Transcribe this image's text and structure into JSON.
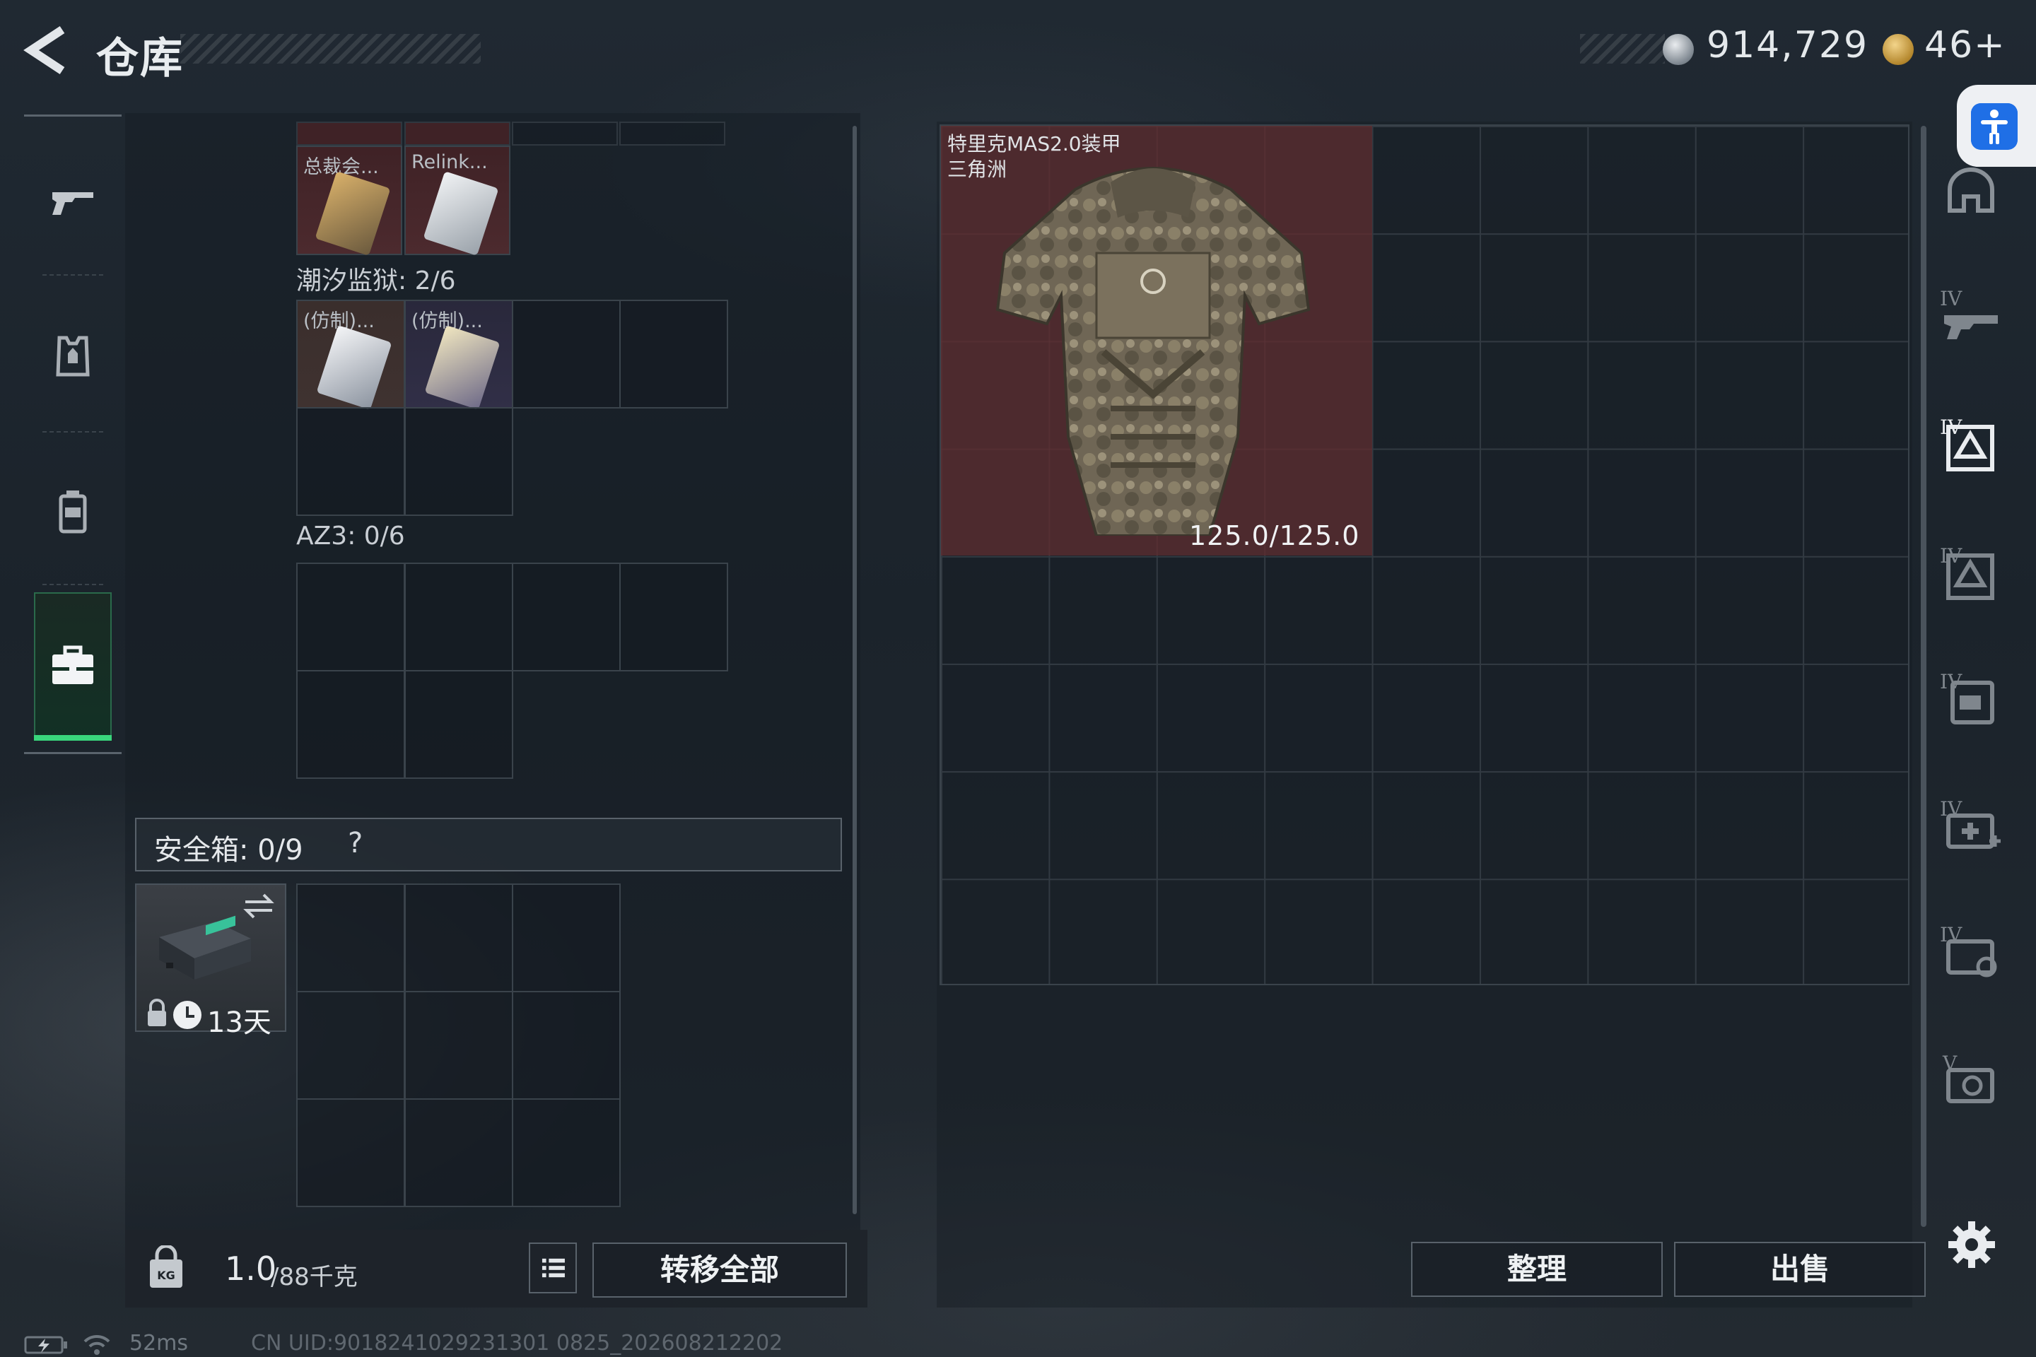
{
  "header": {
    "title": "仓库",
    "currency_silver": "914,729",
    "currency_gold": "46+"
  },
  "nav": {
    "items": [
      "weapons",
      "armor",
      "backpack",
      "storage"
    ],
    "active": "storage"
  },
  "left_panel": {
    "top_items": [
      {
        "name": "总裁会..."
      },
      {
        "name": "Relink..."
      }
    ],
    "sections": [
      {
        "label": "潮汐监狱: 2/6",
        "items": [
          {
            "name": "(仿制)..."
          },
          {
            "name": "(仿制)..."
          }
        ]
      },
      {
        "label": "AZ3: 0/6",
        "items": []
      }
    ],
    "safebox": {
      "label": "安全箱: 0/9",
      "help": "?",
      "timer": "13天"
    }
  },
  "bottom_left": {
    "weight_current": "1.0",
    "weight_max": "/88千克",
    "transfer_all": "转移全部"
  },
  "right_panel": {
    "armor_name": "特里克MAS2.0装甲",
    "armor_origin": "三角洲",
    "armor_durability": "125.0/125.0"
  },
  "bottom_right": {
    "sort": "整理",
    "sell": "出售"
  },
  "right_sidebar": {
    "tiers": [
      "IV",
      "IV",
      "IV",
      "IV",
      "IV",
      "IV",
      "V"
    ]
  },
  "status": {
    "ping": "52ms",
    "uid": "CN UID:9018241029231301 0825_202608212202"
  },
  "colors": {
    "accent_green": "#39d67c",
    "item_red": "#4d2a2e",
    "item_blue": "#312f47",
    "accessibility_blue": "#1f6fe6"
  }
}
